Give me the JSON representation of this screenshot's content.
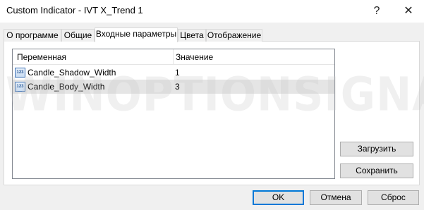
{
  "window": {
    "title": "Custom Indicator - IVT X_Trend 1",
    "help_glyph": "?",
    "close_glyph": "✕"
  },
  "tabs": [
    {
      "label": "О программе",
      "active": false
    },
    {
      "label": "Общие",
      "active": false
    },
    {
      "label": "Входные параметры",
      "active": true
    },
    {
      "label": "Цвета",
      "active": false
    },
    {
      "label": "Отображение",
      "active": false
    }
  ],
  "grid": {
    "headers": {
      "variable": "Переменная",
      "value": "Значение"
    },
    "rows": [
      {
        "icon": "123",
        "name": "Candle_Shadow_Width",
        "value": "1",
        "selected": false
      },
      {
        "icon": "123",
        "name": "Candle_Body_Width",
        "value": "3",
        "selected": true
      }
    ]
  },
  "side_buttons": {
    "load": "Загрузить",
    "save": "Сохранить"
  },
  "bottom_buttons": {
    "ok": "OK",
    "cancel": "Отмена",
    "reset": "Сброс"
  },
  "watermark": "WINOPTIONSIGNALS.COM",
  "colors": {
    "accent": "#0078d7",
    "selected_row": "#e5e5e5",
    "dialog_bg": "#f0f0f0"
  }
}
